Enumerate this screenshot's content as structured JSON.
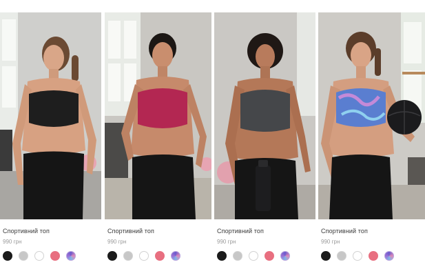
{
  "products": [
    {
      "title": "Спортивний топ",
      "price": "990 грн",
      "photo": "woman-black-sports-bra-photo",
      "top_color": "#1e1e1e"
    },
    {
      "title": "Спортивний топ",
      "price": "990 грн",
      "photo": "woman-crimson-sports-bra-photo",
      "top_color": "#b32752"
    },
    {
      "title": "Спортивний топ",
      "price": "990 грн",
      "photo": "woman-grey-sports-bra-bottle-photo",
      "top_color": "#45474a"
    },
    {
      "title": "Спортивний топ",
      "price": "990 грн",
      "photo": "woman-tiedye-sports-bra-ball-photo",
      "top_color": "#5a7ed0"
    }
  ],
  "swatch_colors": [
    {
      "name": "black",
      "color": "#1b1b1b"
    },
    {
      "name": "grey",
      "color": "#c7c7c7"
    },
    {
      "name": "white",
      "color": "#ffffff"
    },
    {
      "name": "pink",
      "color": "#e86f80"
    },
    {
      "name": "tie-dye",
      "color": "#8a6bd0"
    }
  ]
}
